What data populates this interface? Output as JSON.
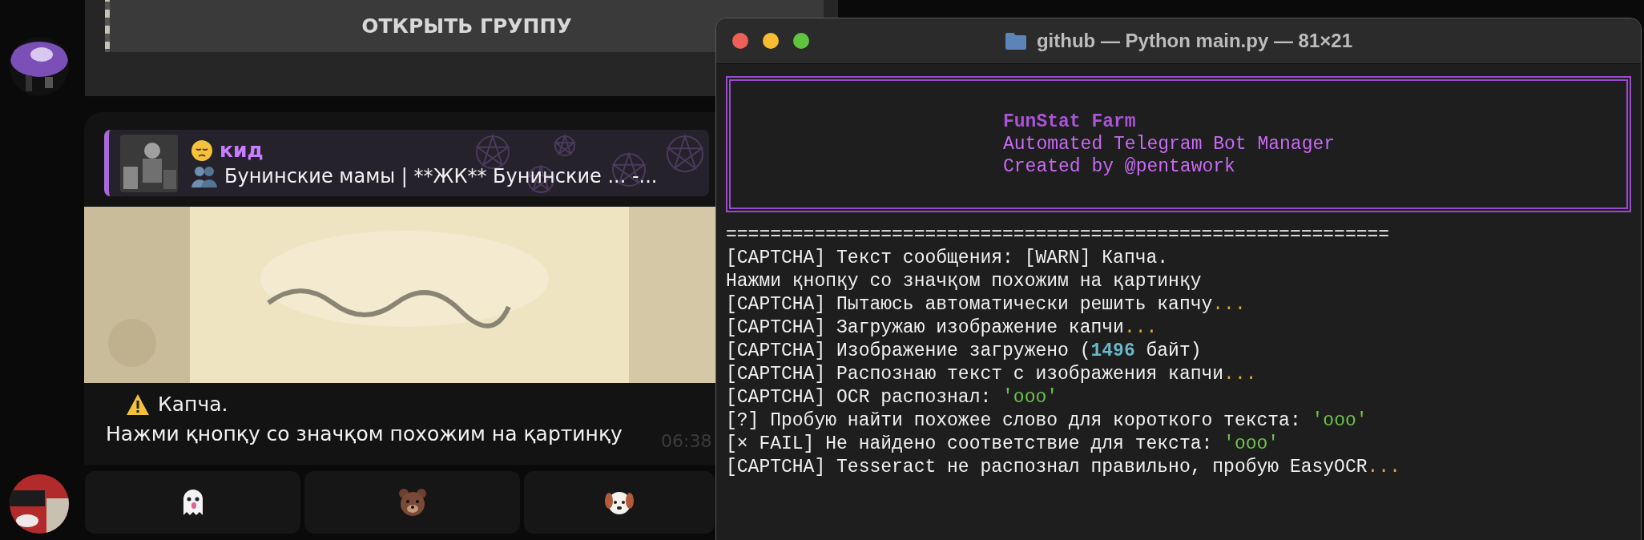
{
  "chat": {
    "open_group_button": "ОТКРЫТЬ ГРУППУ",
    "message": {
      "reply": {
        "author": "кид",
        "text": "Бунинские мамы | **ЖК** Бунинские ... -..."
      },
      "caption_title": "Капча.",
      "caption_text": "Нажми қнопқу со значқом похожим на қартинқу",
      "time": "06:38"
    },
    "buttons": [
      {
        "kind": "ghost"
      },
      {
        "kind": "bear"
      },
      {
        "kind": "dog"
      }
    ]
  },
  "terminal": {
    "title": "github — Python main.py — 81×21",
    "banner": [
      {
        "text": "FunStat Farm",
        "kind": "title"
      },
      {
        "text": "Automated Telegram Bot Manager",
        "kind": "subtitle"
      },
      {
        "text": "Created by @pentawork",
        "kind": "subtitle"
      }
    ],
    "lines": [
      {
        "segments": [
          {
            "text": "============================================================",
            "kind": "plain"
          }
        ]
      },
      {
        "segments": [
          {
            "text": "[CAPTCHA] Текст сообщения: [WARN] Капча.",
            "kind": "plain"
          }
        ]
      },
      {
        "segments": [
          {
            "text": "Нажми қнопқу со значқом похожим на қартинқу",
            "kind": "plain"
          }
        ]
      },
      {
        "segments": [
          {
            "text": "[CAPTCHA] Пытаюсь автоматически решить капчу",
            "kind": "plain"
          },
          {
            "text": "...",
            "kind": "dots"
          }
        ]
      },
      {
        "segments": [
          {
            "text": "[CAPTCHA] Загружаю изображение капчи",
            "kind": "plain"
          },
          {
            "text": "...",
            "kind": "dots"
          }
        ]
      },
      {
        "segments": [
          {
            "text": "[CAPTCHA] Изображение загружено (",
            "kind": "plain"
          },
          {
            "text": "1496",
            "kind": "number"
          },
          {
            "text": " байт)",
            "kind": "plain"
          }
        ]
      },
      {
        "segments": [
          {
            "text": "[CAPTCHA] Распознаю текст с изображения капчи",
            "kind": "plain"
          },
          {
            "text": "...",
            "kind": "dots"
          }
        ]
      },
      {
        "segments": [
          {
            "text": "[CAPTCHA] OCR распознал: ",
            "kind": "plain"
          },
          {
            "text": "'ooo'",
            "kind": "string"
          }
        ]
      },
      {
        "segments": [
          {
            "text": "[?] Пробую найти похожее слово для короткого текста: ",
            "kind": "plain"
          },
          {
            "text": "'ooo'",
            "kind": "string"
          }
        ]
      },
      {
        "segments": [
          {
            "text": "[× FAIL] Не найдено соответствие для текста: ",
            "kind": "plain"
          },
          {
            "text": "'ooo'",
            "kind": "string"
          }
        ]
      },
      {
        "segments": [
          {
            "text": "[CAPTCHA] Tesseract не распознал правильно, пробую EasyOCR",
            "kind": "plain"
          },
          {
            "text": "...",
            "kind": "dots"
          }
        ]
      }
    ]
  }
}
